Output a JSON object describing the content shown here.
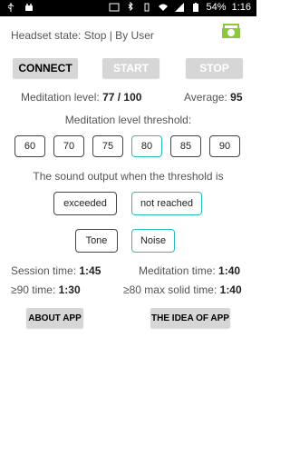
{
  "status_bar": {
    "left_icons": [
      "usb-icon",
      "android-icon"
    ],
    "right_icons": [
      "cast-icon",
      "bluetooth-icon",
      "vibrate-icon",
      "wifi-icon",
      "signal-icon",
      "battery-icon"
    ],
    "battery_text": "54%",
    "time": "1:16"
  },
  "header": {
    "headset_state": "Headset state:  Stop | By User",
    "logo_icon": "headset-logo-icon",
    "accent_color": "#8dc63f"
  },
  "controls": {
    "connect": "CONNECT",
    "start": "START",
    "stop": "STOP"
  },
  "levels": {
    "meditation_label": "Meditation level:",
    "meditation_value": "77 / 100",
    "average_label": "Average:",
    "average_value": "95"
  },
  "threshold": {
    "title": "Meditation level threshold:",
    "options": [
      "60",
      "70",
      "75",
      "80",
      "85",
      "90"
    ],
    "selected": "80"
  },
  "sound": {
    "title": "The sound output when the threshold is",
    "conditions": [
      "exceeded",
      "not reached"
    ],
    "selected_condition": "not reached",
    "types": [
      "Tone",
      "Noise"
    ],
    "selected_type": "Noise"
  },
  "stats": {
    "session_label": "Session time:",
    "session_value": "1:45",
    "meditation_time_label": "Meditation time:",
    "meditation_time_value": "1:40",
    "ge90_label": "≥90 time:",
    "ge90_value": "1:30",
    "ge80_label": "≥80 max solid time:",
    "ge80_value": "1:40"
  },
  "footer": {
    "about": "ABOUT APP",
    "idea": "THE IDEA OF APP"
  },
  "colors": {
    "active_border": "#20c0c0",
    "button_bg": "#d6d6d6"
  }
}
